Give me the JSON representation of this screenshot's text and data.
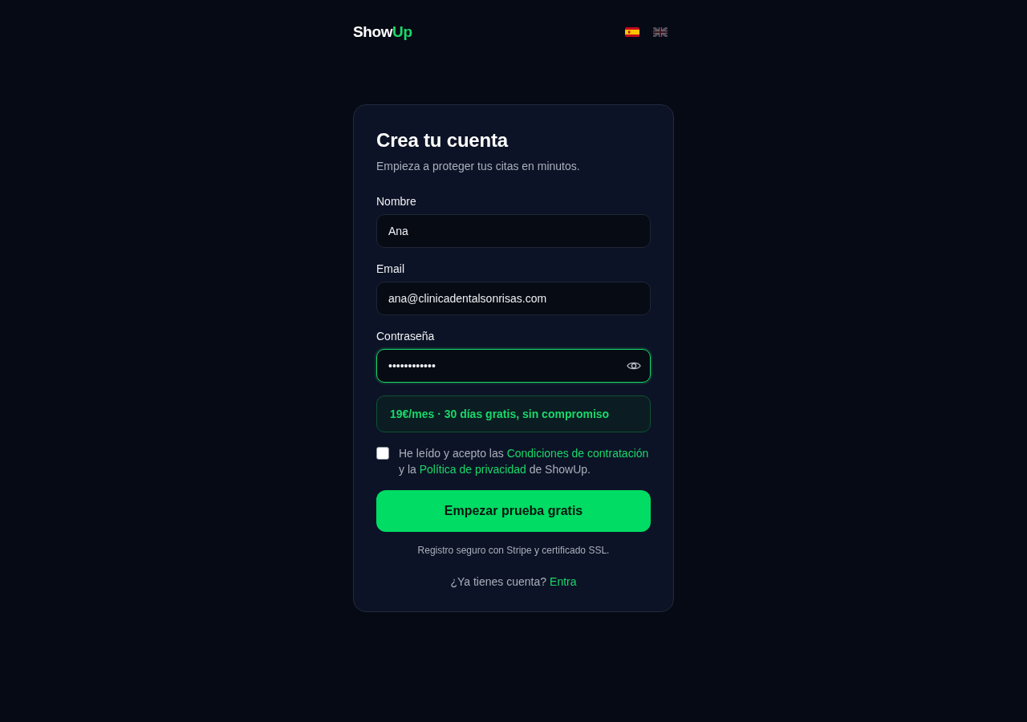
{
  "header": {
    "logo": {
      "part_1": "Show",
      "part_2": "Up"
    },
    "languages": [
      {
        "kind": "es",
        "selected": true
      },
      {
        "kind": "gb",
        "selected": false
      }
    ]
  },
  "card": {
    "title": "Crea tu cuenta",
    "subtitle": "Empieza a proteger tus citas en minutos.",
    "fields": [
      {
        "kind": "text",
        "label": "Nombre",
        "value": "Ana",
        "focused": false
      },
      {
        "kind": "text",
        "label": "Email",
        "value": "ana@clinicadentalsonrisas.com",
        "focused": false
      },
      {
        "kind": "password",
        "label": "Contraseña",
        "value": "••••••••••••",
        "focused": true
      }
    ],
    "promo": "19€/mes · 30 días gratis, sin compromiso",
    "terms": {
      "checked": false,
      "parts": [
        {
          "text": "He leído y acepto las ",
          "link": false
        },
        {
          "text": "Condiciones de contratación",
          "link": true
        },
        {
          "text": " y la ",
          "link": false
        },
        {
          "text": "Política de privacidad",
          "link": true
        },
        {
          "text": " de ShowUp.",
          "link": false
        }
      ]
    },
    "submit": "Empezar prueba gratis",
    "secure_note": "Registro seguro con Stripe y certificado SSL.",
    "login": {
      "prompt": "¿Ya tienes cuenta?",
      "link": "Entra"
    }
  }
}
